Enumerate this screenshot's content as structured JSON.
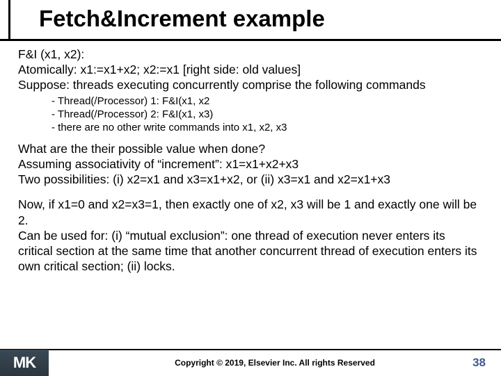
{
  "header": {
    "title": "Fetch&Increment example"
  },
  "body": {
    "l1": "F&I (x1, x2):",
    "l2": "Atomically: x1:=x1+x2; x2:=x1 [right side: old values]",
    "l3": "Suppose: threads executing concurrently comprise the following commands",
    "s1": "- Thread(/Processor) 1: F&I(x1, x2",
    "s2": "- Thread(/Processor) 2: F&I(x1, x3)",
    "s3": "- there are no other write commands into x1, x2, x3",
    "l4": "What are the their possible value when done?",
    "l5": "Assuming associativity of “increment”: x1=x1+x2+x3",
    "l6": "Two possibilities: (i) x2=x1 and x3=x1+x2, or (ii) x3=x1 and x2=x1+x3",
    "l7": "Now, if x1=0 and x2=x3=1, then exactly one of x2, x3 will be 1 and exactly one will be 2.",
    "l8": "Can be used for: (i) “mutual exclusion”: one thread of execution never enters its critical section at the same time that another concurrent thread of execution enters its own critical section; (ii) locks."
  },
  "footer": {
    "copyright": "Copyright © 2019, Elsevier Inc. All rights Reserved",
    "page": "38",
    "logo_initials": "MK"
  }
}
